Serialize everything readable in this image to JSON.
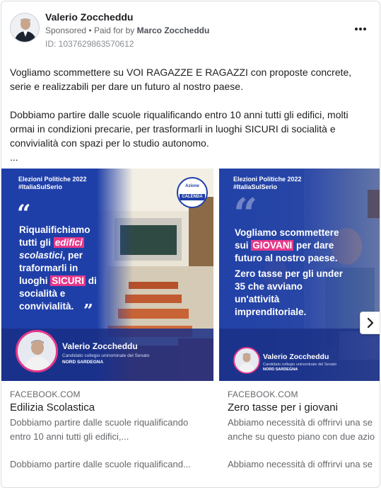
{
  "post": {
    "page_name": "Valerio Zoccheddu",
    "sponsored": "Sponsored",
    "separator": "•",
    "paid_for_by_label": "Paid for by",
    "payer": "Marco Zoccheddu",
    "ad_id": "ID: 1037629863570612",
    "paragraph_1": "Vogliamo scommettere su VOI RAGAZZE E RAGAZZI con proposte concrete, serie e realizzabili per dare un futuro al nostro paese.",
    "paragraph_2": "Dobbiamo partire dalle scuole riqualificando entro 10 anni tutti gli edifici, molti ormai in condizioni precarie, per trasformarli in luoghi SICURI di socialità e convivialità con spazi per lo studio autonomo.",
    "ellipsis": "..."
  },
  "cards": [
    {
      "domain": "FACEBOOK.COM",
      "headline": "Edilizia Scolastica",
      "description": "Dobbiamo partire dalle scuole riqualificando entro 10 anni tutti gli edifici,...",
      "description_2": "Dobbiamo partire dalle scuole riqualificand...",
      "creative": {
        "tag_line_1": "Elezioni Politiche 2022",
        "tag_line_2": "#ItaliaSulSerio",
        "quote_open": "“",
        "quote_close": "”",
        "line_1": "Riqualifichiamo",
        "line_2a": "tutti gli ",
        "line_2b": "edifici",
        "line_3a": "scolastici",
        "line_3b": ", per",
        "line_4": "traformarli in",
        "line_5a": "luoghi ",
        "line_5b": "SICURI",
        "line_5c": " di",
        "line_6": "socialità e",
        "line_7": "convivialità.",
        "person_name": "Valerio Zoccheddu",
        "person_sub_1": "Candidato collegio uninominale del Senato",
        "person_sub_2": "NORD SARDEGNA",
        "logo_text": "CALENDA",
        "logo_top": "Azione"
      }
    },
    {
      "domain": "FACEBOOK.COM",
      "headline": "Zero tasse per i giovani",
      "description": "Abbiamo necessità di offrirvi una se anche su questo piano con due azio",
      "description_line_1": "Abbiamo necessità di offrirvi una se",
      "description_line_2": "anche su questo piano con due azio",
      "description_2": "Abbiamo necessità di offrirvi una se",
      "creative": {
        "tag_line_1": "Elezioni Politiche 2022",
        "tag_line_2": "#ItaliaSulSerio",
        "quote_open": "“",
        "line_1": "Vogliamo scommettere",
        "line_2a": "sui ",
        "line_2b": "GIOVANI",
        "line_2c": " per dare",
        "line_3": "futuro al nostro paese.",
        "line_4": "Zero tasse per gli under",
        "line_5": "35 che avviano",
        "line_6": "un'attività",
        "line_7": "imprenditoriale.",
        "person_name": "Valerio Zoccheddu",
        "person_sub_1": "Candidato collegio uninominale del Senato",
        "person_sub_2": "NORD SARDEGNA"
      }
    }
  ],
  "colors": {
    "creative_blue": "#1f3fa8",
    "highlight_pink": "#e6378a",
    "muted_text": "#65676b"
  },
  "icons": {
    "more": "more-horizontal-icon",
    "next": "chevron-right-icon"
  }
}
